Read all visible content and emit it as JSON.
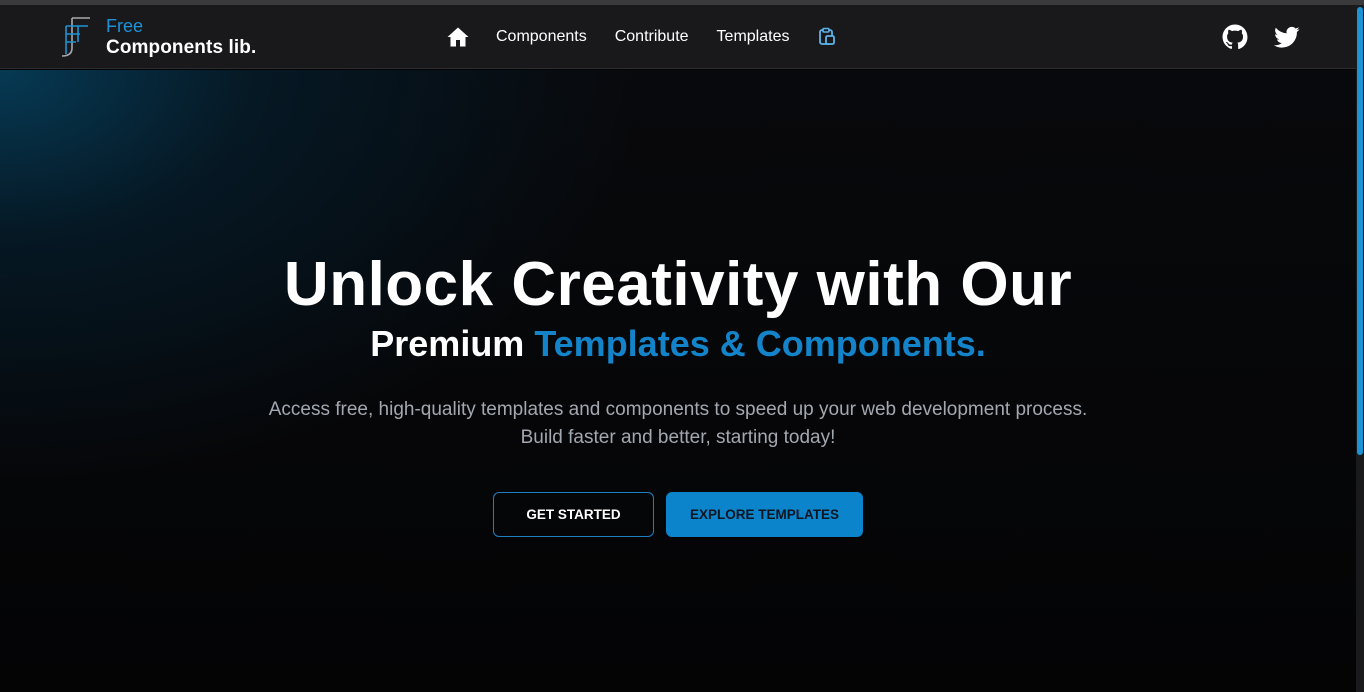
{
  "brand": {
    "line1": "Free",
    "line2": "Components lib.",
    "icon": "logo-f-mark",
    "accent_color": "#1d93d6"
  },
  "nav": {
    "home_icon": "home-icon",
    "links": [
      "Components",
      "Contribute",
      "Templates"
    ],
    "extra_icon": "clipboard-icon",
    "social": [
      "github-icon",
      "twitter-icon"
    ]
  },
  "hero": {
    "title": "Unlock Creativity with Our",
    "subtitle_plain": "Premium",
    "subtitle_accent": "Templates & Components.",
    "description": "Access free, high-quality templates and components to speed up your web development process. Build faster and better, starting today!",
    "primary_color": "#0b84cc"
  },
  "actions": {
    "get_started": "GET STARTED",
    "explore_templates": "EXPLORE TEMPLATES"
  }
}
